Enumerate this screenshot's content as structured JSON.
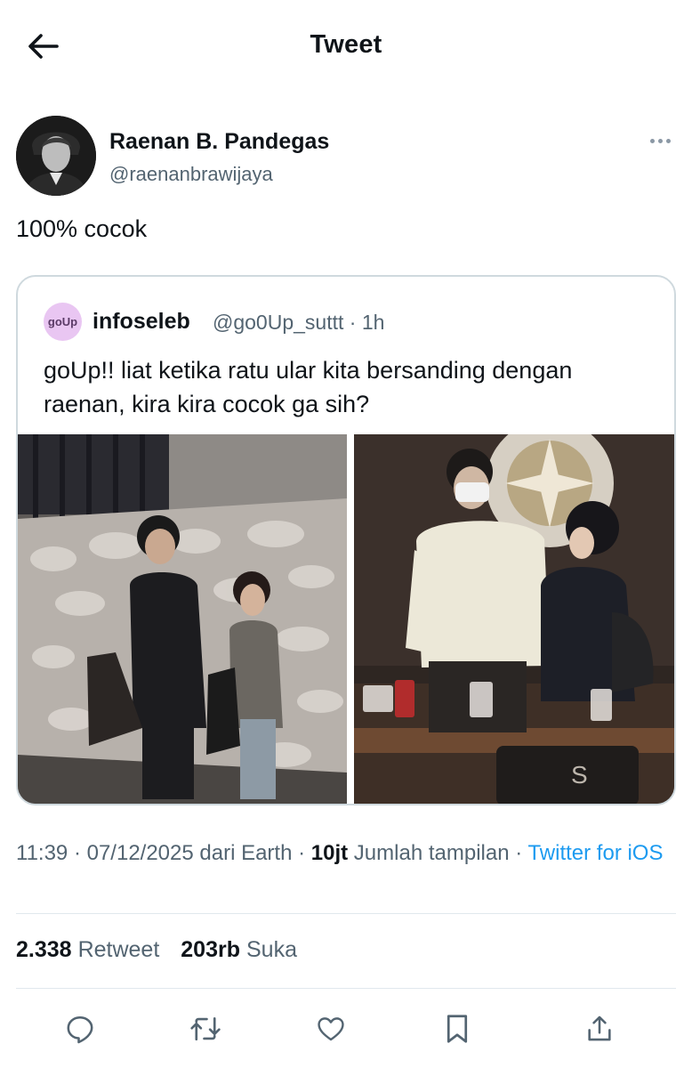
{
  "header": {
    "title": "Tweet"
  },
  "author": {
    "name": "Raenan B. Pandegas",
    "handle": "@raenanbrawijaya"
  },
  "tweet": {
    "text": "100% cocok"
  },
  "quoted": {
    "avatar_text": "goUp",
    "name": "infoseleb",
    "handle_time": "@go0Up_suttt · 1h",
    "text": "goUp!! liat ketika ratu ular kita bersanding dengan raenan, kira kira cocok ga sih?"
  },
  "meta": {
    "time_date_source": "11:39 · 07/12/2025 dari Earth · ",
    "views_count": "10jt",
    "views_label": " Jumlah tampilan · ",
    "client": "Twitter for iOS"
  },
  "stats": {
    "retweet_count": "2.338",
    "retweet_label": "Retweet",
    "like_count": "203rb",
    "like_label": "Suka"
  },
  "icons": {
    "back": "arrow-left-icon",
    "more": "ellipsis-icon",
    "reply": "reply-icon",
    "retweet": "retweet-icon",
    "like": "heart-icon",
    "bookmark": "bookmark-icon",
    "share": "share-icon"
  },
  "colors": {
    "link": "#1d9bf0",
    "secondary_text": "#536471",
    "border": "#cfd9de"
  }
}
